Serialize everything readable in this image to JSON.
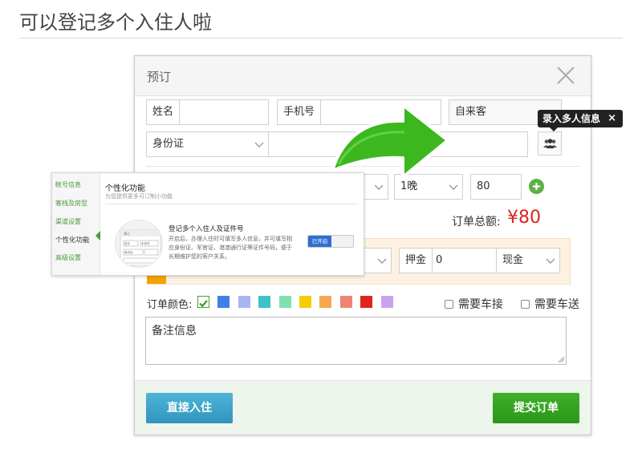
{
  "heading": "可以登记多个入住人啦",
  "dialog": {
    "title": "预订",
    "name_label": "姓名",
    "name_value": "",
    "phone_label": "手机号",
    "phone_value": "",
    "source_select": "自来客",
    "id_type_select": "身份证",
    "id_number": "",
    "nights_select": "1晚",
    "price_value": "80",
    "total_label": "订单总额:",
    "total_value": "¥80",
    "deposit_label": "押金",
    "deposit_value": "0",
    "payment_select": "现金",
    "color_label": "订单颜色:",
    "swatch_colors": [
      "#ffffff",
      "#3f7fe8",
      "#a8b7f0",
      "#3fc2c9",
      "#80e0b2",
      "#f5cd00",
      "#f6a84e",
      "#f08474",
      "#e0261c",
      "#c8a3ee"
    ],
    "selected_color_index": 0,
    "pickup_label": "需要车接",
    "dropoff_label": "需要车送",
    "remarks": "备注信息",
    "checkin_button": "直接入住",
    "submit_button": "提交订单"
  },
  "tooltip": {
    "text": "录入多人信息",
    "close": "×"
  },
  "settings_popup": {
    "sidebar": [
      "帐号信息",
      "客栈及房型",
      "渠道设置",
      "个性化功能",
      "高级设置"
    ],
    "active_index": 3,
    "title": "个性化功能",
    "subtitle": "为您提供更多可订制小功能",
    "feature_title": "登记多个入住人及证件号",
    "feature_desc": "开启后，办理入住时可填写多人信息，并可填写相应身份证、军官证、港澳通行证等证件号码，便于长期维护您的客户关系。",
    "toggle_label": "已开启",
    "toggle_on": true,
    "thumb": {
      "heading": "预订",
      "name": "姓名",
      "phone": "手机号",
      "id": "身份证"
    }
  },
  "colors": {
    "total_red": "#d9251c",
    "checkin_blue": "#3aa4ca",
    "submit_green": "#2fa11d",
    "arrow_green": "#3cb81e",
    "add_icon_green": "#5cb044",
    "toggle_blue": "#2f6fd0",
    "payment_panel": "#fdf2e2"
  }
}
